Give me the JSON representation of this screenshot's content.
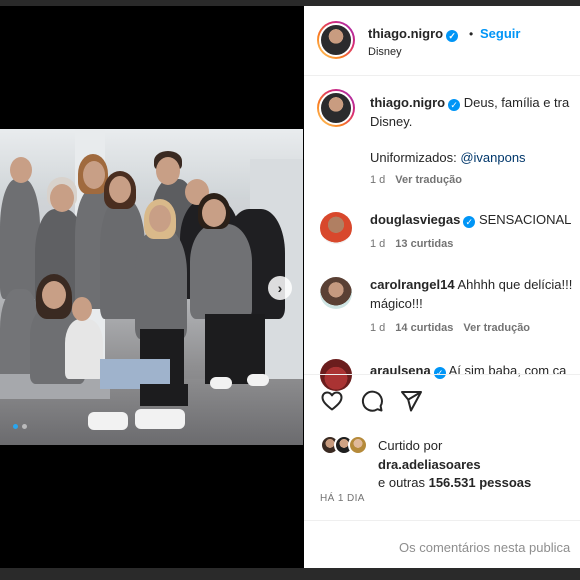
{
  "post": {
    "author": "thiago.nigro",
    "follow_label": "Seguir",
    "separator": "•",
    "location": "Disney",
    "caption_line1": "Deus, família e tra",
    "caption_line2": "Disney.",
    "caption_line3_prefix": "Uniformizados: ",
    "caption_mention": "@ivanpons",
    "caption_meta_time": "1 d",
    "caption_meta_translate": "Ver tradução"
  },
  "comments": [
    {
      "user": "douglasviegas",
      "text": "SENSACIONAL",
      "time": "1 d",
      "likes": "13 curtidas",
      "translate": ""
    },
    {
      "user": "carolrangel14",
      "text_line1": "Ahhhh que delícia!!!",
      "text_line2": "mágico!!!",
      "time": "1 d",
      "likes": "14 curtidas",
      "translate": "Ver tradução"
    },
    {
      "user": "araulsena",
      "text": "Aí sim baba, com ca"
    }
  ],
  "likes": {
    "prefix": "Curtido por",
    "user": "dra.adeliasoares",
    "suffix_prefix": "e outras ",
    "count": "156.531 pessoas"
  },
  "time_ago": "HÁ 1 DIA",
  "comment_placeholder": "Os comentários nesta publica",
  "icons": {
    "like": "heart-icon",
    "comment": "comment-icon",
    "share": "send-icon",
    "next": "chevron-right-icon",
    "verified": "verified-badge-icon"
  },
  "colors": {
    "accent": "#0095f6",
    "text": "#262626",
    "muted": "#737373"
  }
}
